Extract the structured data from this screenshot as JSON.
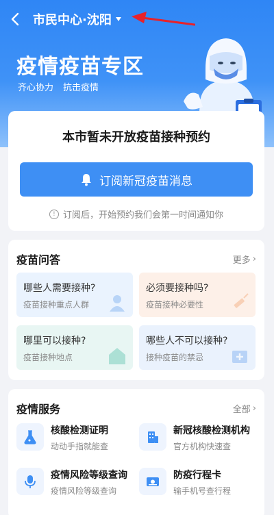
{
  "nav": {
    "city": "市民中心·沈阳"
  },
  "hero": {
    "title": "疫情疫苗专区",
    "slogan1": "齐心协力",
    "slogan2": "抗击疫情"
  },
  "booking": {
    "title": "本市暂未开放疫苗接种预约",
    "subscribe_label": "订阅新冠疫苗消息",
    "note": "订阅后，开始预约我们会第一时间通知你"
  },
  "qa": {
    "title": "疫苗问答",
    "more": "更多",
    "tiles": [
      {
        "title": "哪些人需要接种?",
        "sub": "疫苗接种重点人群",
        "icon": "person-icon"
      },
      {
        "title": "必须要接种吗?",
        "sub": "疫苗接种必要性",
        "icon": "syringe-icon"
      },
      {
        "title": "哪里可以接种?",
        "sub": "疫苗接种地点",
        "icon": "home-icon"
      },
      {
        "title": "哪些人不可以接种?",
        "sub": "接种疫苗的禁忌",
        "icon": "medical-box-icon"
      }
    ]
  },
  "services": {
    "title": "疫情服务",
    "all": "全部",
    "items": [
      {
        "title": "核酸检测证明",
        "sub": "动动手指就能查",
        "icon": "flask-icon"
      },
      {
        "title": "新冠核酸检测机构",
        "sub": "官方机构快速查",
        "icon": "building-icon"
      },
      {
        "title": "疫情风险等级查询",
        "sub": "疫情风险等级查询",
        "icon": "microphone-icon"
      },
      {
        "title": "防疫行程卡",
        "sub": "输手机号查行程",
        "icon": "card-icon"
      }
    ]
  },
  "colors": {
    "primary": "#3e8ff4",
    "annotation": "#e8222a"
  }
}
